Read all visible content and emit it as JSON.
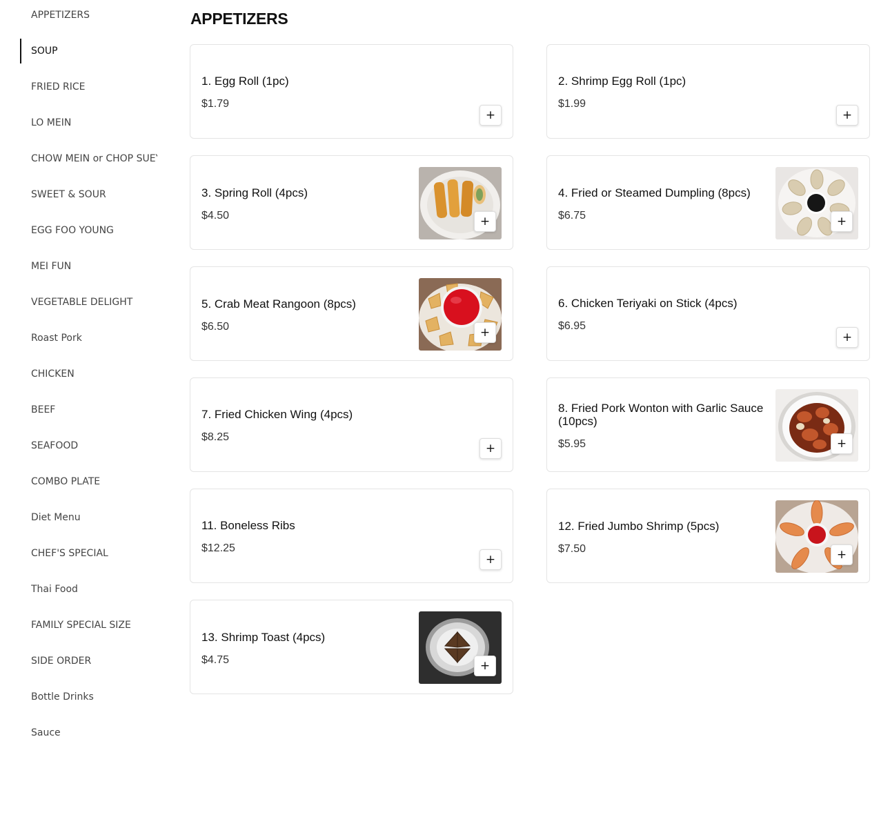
{
  "sidebar": {
    "active_index": 1,
    "items": [
      {
        "label": "APPETIZERS"
      },
      {
        "label": "SOUP"
      },
      {
        "label": "FRIED RICE"
      },
      {
        "label": "LO MEIN"
      },
      {
        "label": "CHOW MEIN or CHOP SUEY"
      },
      {
        "label": "SWEET & SOUR"
      },
      {
        "label": "EGG FOO YOUNG"
      },
      {
        "label": "MEI FUN"
      },
      {
        "label": "VEGETABLE DELIGHT"
      },
      {
        "label": "Roast Pork"
      },
      {
        "label": "CHICKEN"
      },
      {
        "label": "BEEF"
      },
      {
        "label": "SEAFOOD"
      },
      {
        "label": "COMBO PLATE"
      },
      {
        "label": "Diet Menu"
      },
      {
        "label": "CHEF'S SPECIAL"
      },
      {
        "label": "Thai Food"
      },
      {
        "label": "FAMILY SPECIAL SIZE"
      },
      {
        "label": "SIDE ORDER"
      },
      {
        "label": "Bottle Drinks"
      },
      {
        "label": "Sauce"
      }
    ]
  },
  "section": {
    "title": "APPETIZERS"
  },
  "add_label": "+",
  "items": [
    {
      "name": "1. Egg Roll (1pc)",
      "price": "$1.79",
      "image": null
    },
    {
      "name": "2. Shrimp Egg Roll (1pc)",
      "price": "$1.99",
      "image": null
    },
    {
      "name": "3. Spring Roll (4pcs)",
      "price": "$4.50",
      "image": "spring-roll-photo"
    },
    {
      "name": "4. Fried or Steamed Dumpling (8pcs)",
      "price": "$6.75",
      "image": "dumpling-photo"
    },
    {
      "name": "5. Crab Meat Rangoon (8pcs)",
      "price": "$6.50",
      "image": "crab-rangoon-photo"
    },
    {
      "name": "6. Chicken Teriyaki on Stick (4pcs)",
      "price": "$6.95",
      "image": null
    },
    {
      "name": "7. Fried Chicken Wing (4pcs)",
      "price": "$8.25",
      "image": null
    },
    {
      "name": "8. Fried Pork Wonton with Garlic Sauce (10pcs)",
      "price": "$5.95",
      "image": "pork-wonton-photo"
    },
    {
      "name": "11. Boneless Ribs",
      "price": "$12.25",
      "image": null
    },
    {
      "name": "12. Fried Jumbo Shrimp (5pcs)",
      "price": "$7.50",
      "image": "jumbo-shrimp-photo"
    },
    {
      "name": "13. Shrimp Toast (4pcs)",
      "price": "$4.75",
      "image": "shrimp-toast-photo"
    }
  ]
}
